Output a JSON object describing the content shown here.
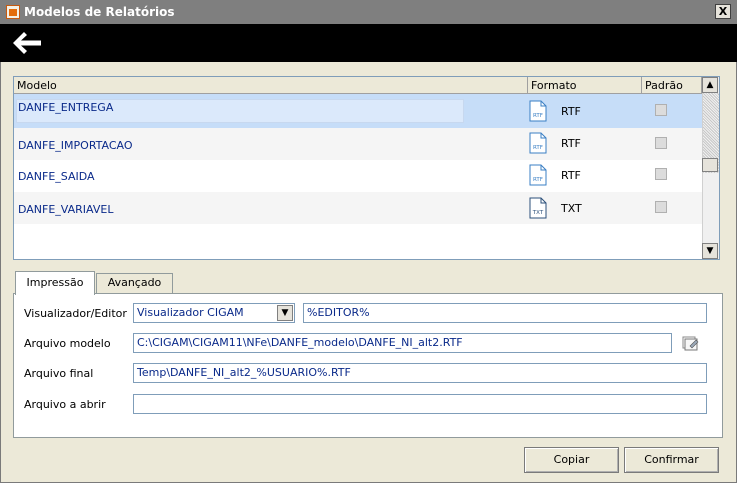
{
  "window": {
    "title": "Modelos de Relatórios",
    "close_label": "X"
  },
  "grid": {
    "columns": [
      "Modelo",
      "Formato",
      "Padrão"
    ],
    "rows": [
      {
        "model": "DANFE_ENTREGA",
        "format_icon": "RTF",
        "format": "RTF",
        "default": false
      },
      {
        "model": "DANFE_IMPORTACAO",
        "format_icon": "RTF",
        "format": "RTF",
        "default": false
      },
      {
        "model": "DANFE_SAIDA",
        "format_icon": "RTF",
        "format": "RTF",
        "default": false
      },
      {
        "model": "DANFE_VARIAVEL",
        "format_icon": "TXT",
        "format": "TXT",
        "default": false
      }
    ],
    "selected_row": 0
  },
  "tabs": [
    {
      "label": "Impressão",
      "active": true
    },
    {
      "label": "Avançado",
      "active": false
    }
  ],
  "form": {
    "viewer_label": "Visualizador/Editor",
    "viewer_select": "Visualizador CIGAM",
    "viewer_field": "%EDITOR%",
    "template_label": "Arquivo modelo",
    "template_value": "C:\\CIGAM\\CIGAM11\\NFe\\DANFE_modelo\\DANFE_NI_alt2.RTF",
    "final_label": "Arquivo final",
    "final_value": "Temp\\DANFE_NI_alt2_%USUARIO%.RTF",
    "open_label": "Arquivo a abrir",
    "open_value": ""
  },
  "buttons": {
    "copy": "Copiar",
    "confirm": "Confirmar"
  },
  "icons": {
    "back": "arrow-left-icon",
    "browse": "folder-browse-icon",
    "scroll_up": "arrow-up-icon",
    "scroll_down": "arrow-down-icon",
    "select_arrow": "chevron-down-icon"
  },
  "colors": {
    "selected_row": "#c6ddf8",
    "titlebar": "#7f7f7f",
    "toolbar": "#000000",
    "link_text": "#0a2a8a"
  }
}
